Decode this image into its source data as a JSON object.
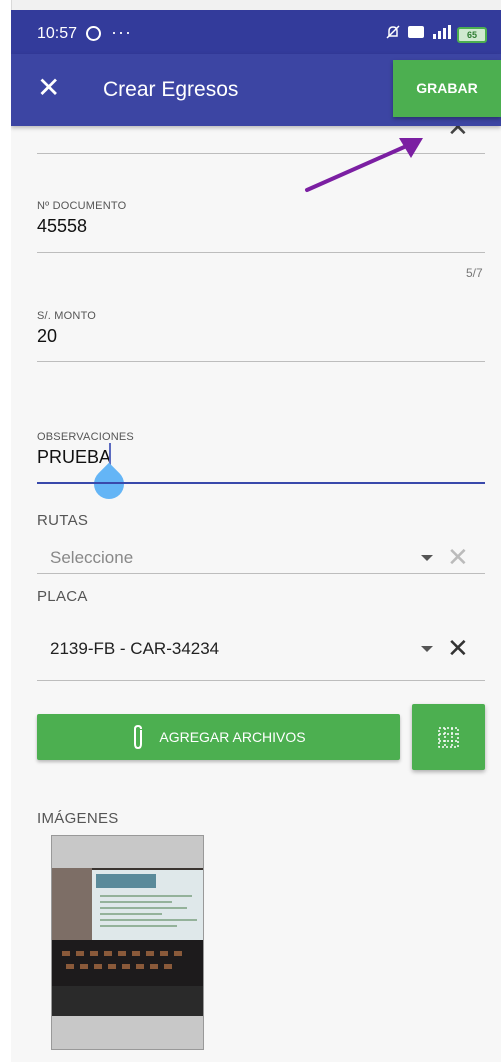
{
  "status_bar": {
    "time": "10:57",
    "more": "···",
    "battery": "65"
  },
  "app_bar": {
    "title": "Crear Egresos",
    "save_label": "GRABAR"
  },
  "form": {
    "documento": {
      "label": "Nº DOCUMENTO",
      "value": "45558",
      "counter": "5/7"
    },
    "monto": {
      "label": "S/. MONTO",
      "value": "20"
    },
    "observaciones": {
      "label": "OBSERVACIONES",
      "value": "PRUEBA"
    },
    "rutas": {
      "label": "RUTAS",
      "placeholder": "Seleccione"
    },
    "placa": {
      "label": "PLACA",
      "value": "2139-FB - CAR-34234"
    }
  },
  "actions": {
    "add_files_label": "AGREGAR ARCHIVOS"
  },
  "images": {
    "label": "IMÁGENES"
  },
  "colors": {
    "primary": "#3c45a3",
    "accent": "#4caf50",
    "annotation_arrow": "#7b1fa2",
    "cursor_handle": "#64b5f6"
  }
}
